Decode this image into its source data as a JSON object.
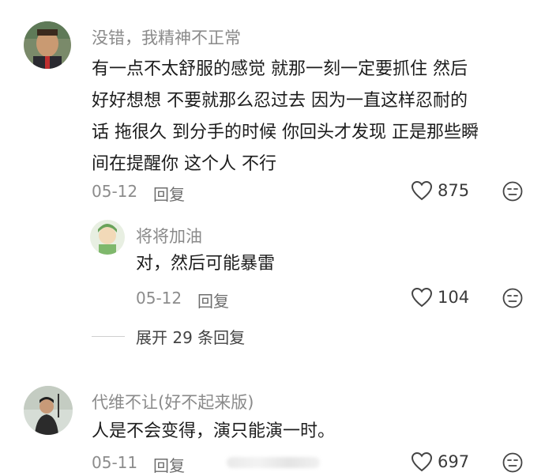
{
  "comments": [
    {
      "username": "没错，我精神不正常",
      "text_lines": [
        "有一点不太舒服的感觉 就那一刻一定要抓住 然后",
        "好好想想 不要就那么忍过去 因为一直这样忍耐的",
        "话 拖很久 到分手的时候 你回头才发现 正是那些瞬",
        "间在提醒你 这个人 不行"
      ],
      "date": "05-12",
      "reply_label": "回复",
      "likes": "875",
      "replies": [
        {
          "username": "将将加油",
          "text": "对，然后可能暴雷",
          "date": "05-12",
          "reply_label": "回复",
          "likes": "104"
        }
      ],
      "expand_label": "展开 29 条回复"
    },
    {
      "username": "代维不让(好不起来版)",
      "text": "人是不会变得，演只能演一时。",
      "date": "05-11",
      "reply_label": "回复",
      "likes": "697"
    }
  ],
  "colors": {
    "username": "#8a8a8a",
    "text": "#1c1c1c",
    "meta": "#8c8c8c"
  },
  "icons": {
    "like": "heart-outline-icon",
    "dislike": "unamused-face-icon"
  }
}
